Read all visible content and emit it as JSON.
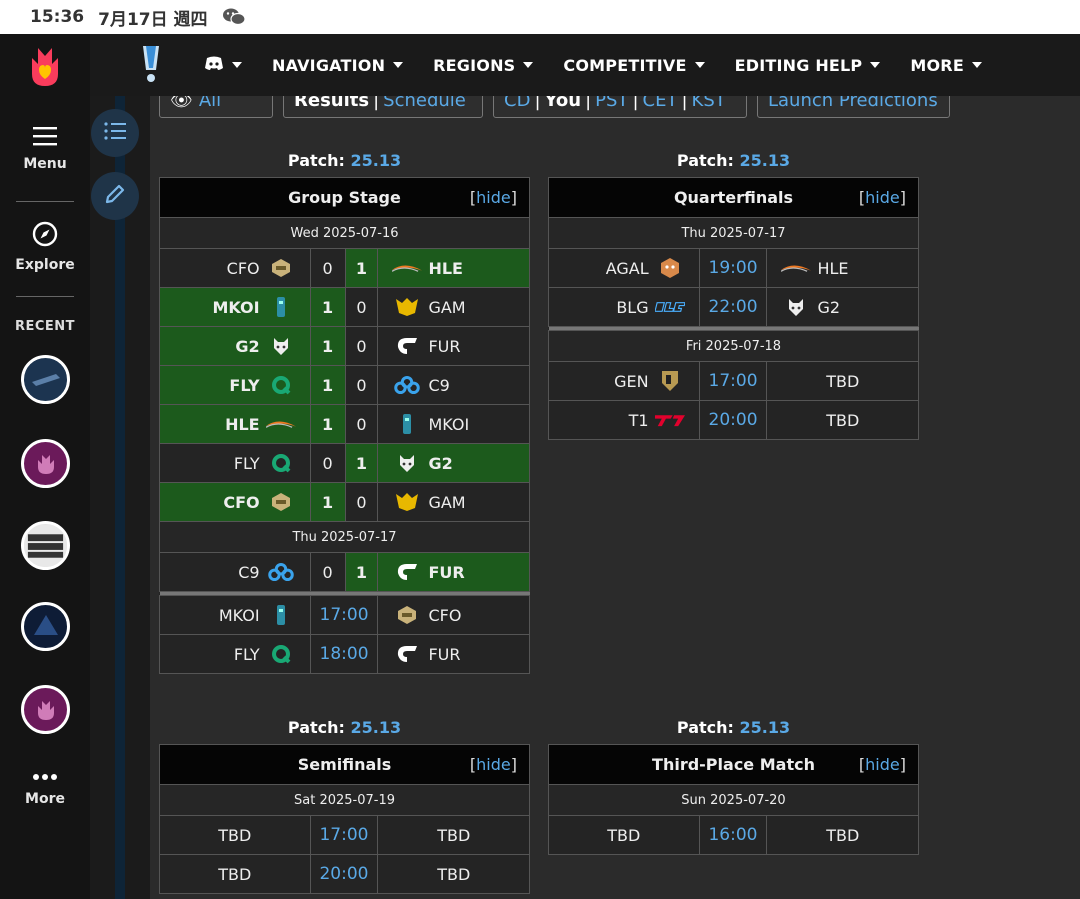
{
  "status": {
    "time": "15:36",
    "date": "7月17日 週四"
  },
  "rail": {
    "menu": "Menu",
    "explore": "Explore",
    "recent": "RECENT",
    "more": "More"
  },
  "nav": {
    "items": [
      "NAVIGATION",
      "REGIONS",
      "COMPETITIVE",
      "EDITING HELP",
      "MORE"
    ]
  },
  "toolbar": {
    "hide_all": "Hide All",
    "results": "Results",
    "schedule": "Schedule",
    "tz_cd": "CD",
    "tz_you": "You",
    "tz_pst": "PST",
    "tz_cet": "CET",
    "tz_kst": "KST",
    "launch": "Launch Predictions"
  },
  "patch_label": "Patch:",
  "patch_value": "25.13",
  "hide_label": "hide",
  "group": {
    "title": "Group Stage",
    "date1": "Wed 2025-07-16",
    "date2": "Thu 2025-07-17",
    "rows": [
      {
        "t1": "CFO",
        "s1": "0",
        "s2": "1",
        "t2": "HLE"
      },
      {
        "t1": "MKOI",
        "s1": "1",
        "s2": "0",
        "t2": "GAM"
      },
      {
        "t1": "G2",
        "s1": "1",
        "s2": "0",
        "t2": "FUR"
      },
      {
        "t1": "FLY",
        "s1": "1",
        "s2": "0",
        "t2": "C9"
      },
      {
        "t1": "HLE",
        "s1": "1",
        "s2": "0",
        "t2": "MKOI"
      },
      {
        "t1": "FLY",
        "s1": "0",
        "s2": "1",
        "t2": "G2"
      },
      {
        "t1": "CFO",
        "s1": "1",
        "s2": "0",
        "t2": "GAM"
      },
      {
        "t1": "C9",
        "s1": "0",
        "s2": "1",
        "t2": "FUR"
      },
      {
        "t1": "MKOI",
        "time": "17:00",
        "t2": "CFO"
      },
      {
        "t1": "FLY",
        "time": "18:00",
        "t2": "FUR"
      }
    ]
  },
  "quarter": {
    "title": "Quarterfinals",
    "date1": "Thu 2025-07-17",
    "date2": "Fri 2025-07-18",
    "rows": [
      {
        "t1": "AGAL",
        "time": "19:00",
        "t2": "HLE"
      },
      {
        "t1": "BLG",
        "time": "22:00",
        "t2": "G2"
      },
      {
        "t1": "GEN",
        "time": "17:00",
        "t2": "TBD"
      },
      {
        "t1": "T1",
        "time": "20:00",
        "t2": "TBD"
      }
    ]
  },
  "semi": {
    "title": "Semifinals",
    "date1": "Sat 2025-07-19",
    "rows": [
      {
        "t1": "TBD",
        "time": "17:00",
        "t2": "TBD"
      },
      {
        "t1": "TBD",
        "time": "20:00",
        "t2": "TBD"
      }
    ]
  },
  "third": {
    "title": "Third-Place Match",
    "date1": "Sun 2025-07-20",
    "rows": [
      {
        "t1": "TBD",
        "time": "16:00",
        "t2": "TBD"
      }
    ]
  },
  "colors": {
    "accent": "#5aa9e6",
    "win": "#1c5a1c",
    "header": "#050505"
  }
}
